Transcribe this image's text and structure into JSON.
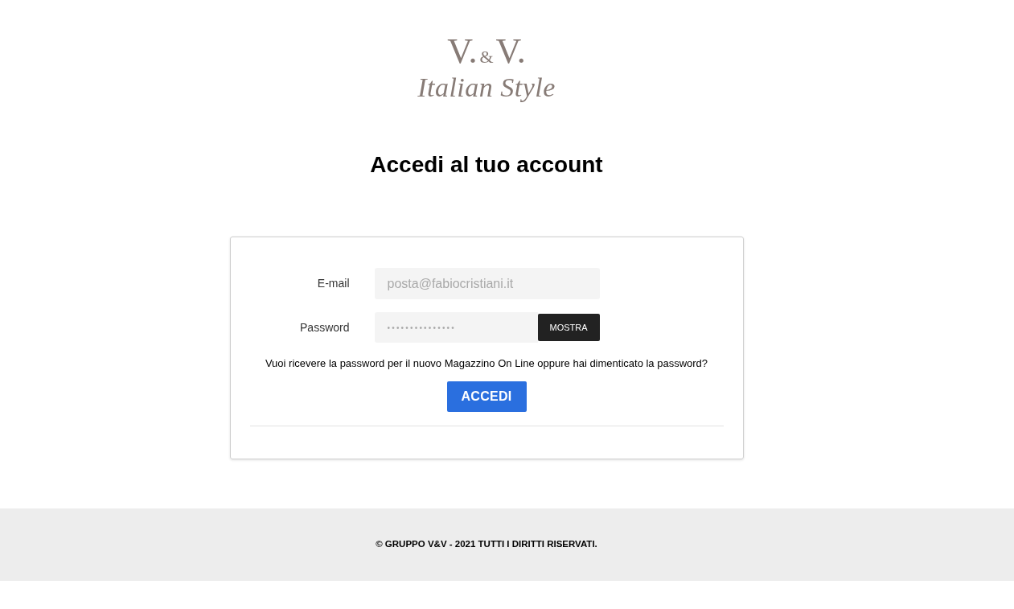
{
  "logo": {
    "monogram": [
      {
        "text": "V.",
        "kind": "letter"
      },
      {
        "text": "&",
        "kind": "ampersand"
      },
      {
        "text": "V.",
        "kind": "letter"
      }
    ],
    "tagline": "Italian Style"
  },
  "heading": "Accedi al tuo account",
  "form": {
    "fields": [
      {
        "kind": "email",
        "label": "E-mail",
        "placeholder": "posta@fabiocristiani.it"
      },
      {
        "kind": "password",
        "label": "Password",
        "placeholder": "•••••••••••••••",
        "toggle": "MOSTRA"
      }
    ],
    "help_text": "Vuoi ricevere la password per il nuovo Magazzino On Line oppure hai dimenticato la password?",
    "submit": "ACCEDI"
  },
  "footer": {
    "copyright": "© GRUPPO V&V - 2021 TUTTI I DIRITTI RISERVATI."
  }
}
